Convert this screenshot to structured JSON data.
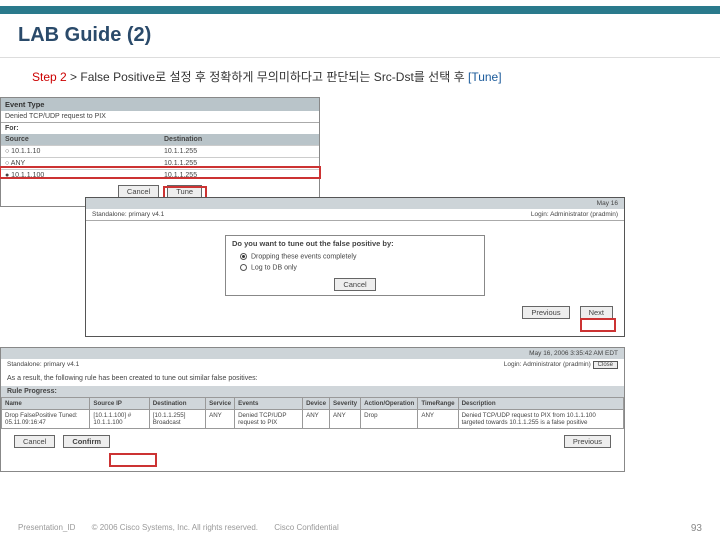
{
  "title": "LAB Guide (2)",
  "instruction": {
    "step": "Step 2",
    "sep": " > ",
    "body": "False Positive로 설정 후 정확하게 무의미하다고 판단되는 Src-Dst를 선택 후 ",
    "tune": "[Tune]"
  },
  "panel1": {
    "event_type_hdr": "Event Type",
    "event_type_val": "Denied TCP/UDP request to PIX",
    "for_label": "For:",
    "src_hdr": "Source",
    "dst_hdr": "Destination",
    "rows": [
      {
        "src": "○ 10.1.1.10",
        "dst": "10.1.1.255"
      },
      {
        "src": "○ ANY",
        "dst": "10.1.1.255"
      },
      {
        "src": "● 10.1.1.100",
        "dst": "10.1.1.255"
      }
    ],
    "cancel": "Cancel",
    "tune": "Tune"
  },
  "panel2": {
    "date": "May 16",
    "standalone": "Standalone: primary v4.1",
    "login": "Login: Administrator (pradmin)",
    "question": "Do you want to tune out the false positive by:",
    "opt1": "Dropping these events completely",
    "opt2": "Log to DB only",
    "cancel": "Cancel",
    "prev": "Previous",
    "next": "Next"
  },
  "panel3": {
    "date": "May 16, 2006 3:35:42 AM EDT",
    "standalone": "Standalone: primary v4.1",
    "login": "Login: Administrator (pradmin)",
    "close": "Close",
    "result_text": "As a result, the following rule has been created to tune out similar false positives:",
    "rule_progress": "Rule Progress:",
    "headers": [
      "Name",
      "Source IP",
      "Destination",
      "Service",
      "Events",
      "Device",
      "Severity",
      "Action/Operation",
      "TimeRange",
      "Description"
    ],
    "row": {
      "name": "Drop FalsePositive Tuned: 05.11.09:16:47",
      "src": "[10.1.1.100] # 10.1.1.100",
      "dst": "[10.1.1.255] Broadcast",
      "svc": "ANY",
      "evt": "Denied TCP/UDP request to PIX",
      "dev": "ANY",
      "sev": "ANY",
      "act": "Drop",
      "time": "ANY",
      "desc": "Denied TCP/UDP request to PIX from 10.1.1.100 targeted towards 10.1.1.255 is a false positive"
    },
    "cancel": "Cancel",
    "confirm": "Confirm",
    "prev": "Previous"
  },
  "footer": {
    "pres_id": "Presentation_ID",
    "copyright": "© 2006 Cisco Systems, Inc. All rights reserved.",
    "conf": "Cisco Confidential",
    "page": "93"
  }
}
